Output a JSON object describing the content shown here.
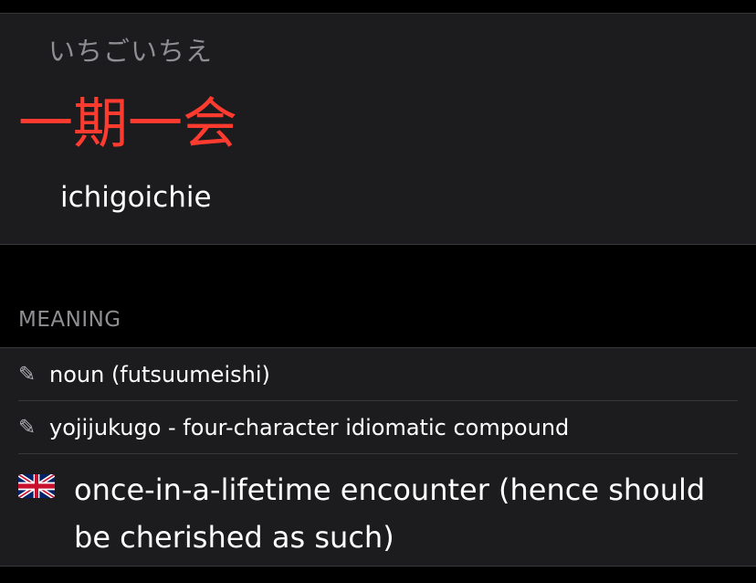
{
  "entry": {
    "reading": "いちごいちえ",
    "kanji": "一期一会",
    "romaji": "ichigoichie"
  },
  "meaning_section": {
    "title": "MEANING",
    "parts_of_speech": [
      {
        "icon": "pencil-icon",
        "text": "noun (futsuumeishi)"
      },
      {
        "icon": "pencil-icon",
        "text": "yojijukugo - four-character idiomatic compound"
      }
    ],
    "gloss": {
      "icon": "uk-flag-icon",
      "text": "once-in-a-lifetime encounter (hence should be cherished as such)"
    }
  },
  "colors": {
    "background": "#000000",
    "card": "#1c1c1e",
    "kanji": "#ff3b30",
    "secondary_text": "#8e8e93",
    "separator": "#38383a"
  }
}
